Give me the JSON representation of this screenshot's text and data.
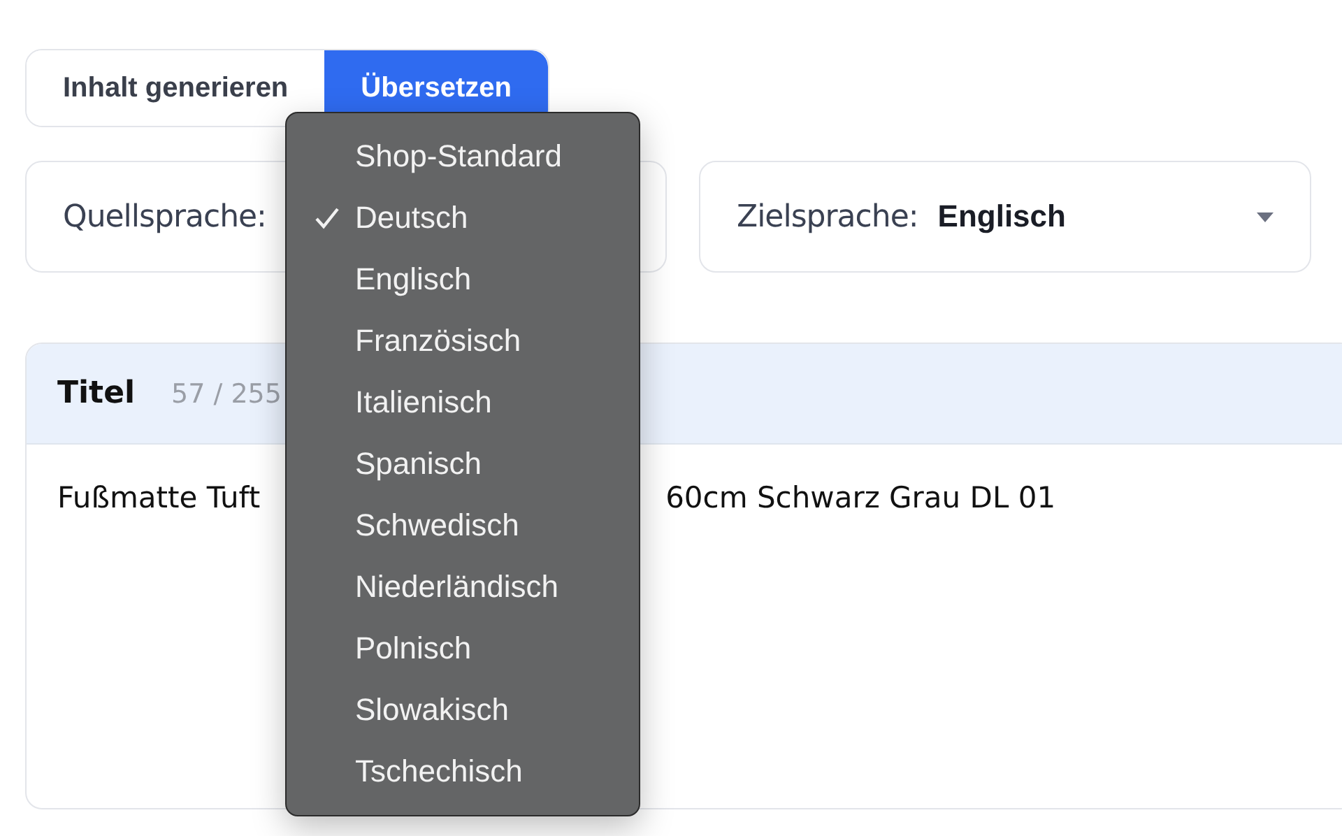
{
  "tabs": [
    {
      "label": "Inhalt generieren",
      "selected": false
    },
    {
      "label": "Übersetzen",
      "selected": true
    }
  ],
  "source_select": {
    "label": "Quellsprache:"
  },
  "target_select": {
    "label": "Zielsprache:",
    "value": "Englisch"
  },
  "title_field": {
    "label": "Titel",
    "count": "57 / 255",
    "text_start": "Fußmatte Tuft",
    "text_end": "60cm Schwarz Grau DL 01"
  },
  "dropdown": {
    "items": [
      {
        "label": "Shop-Standard",
        "selected": false
      },
      {
        "label": "Deutsch",
        "selected": true
      },
      {
        "label": "Englisch",
        "selected": false
      },
      {
        "label": "Französisch",
        "selected": false
      },
      {
        "label": "Italienisch",
        "selected": false
      },
      {
        "label": "Spanisch",
        "selected": false
      },
      {
        "label": "Schwedisch",
        "selected": false
      },
      {
        "label": "Niederländisch",
        "selected": false
      },
      {
        "label": "Polnisch",
        "selected": false
      },
      {
        "label": "Slowakisch",
        "selected": false
      },
      {
        "label": "Tschechisch",
        "selected": false
      }
    ]
  }
}
